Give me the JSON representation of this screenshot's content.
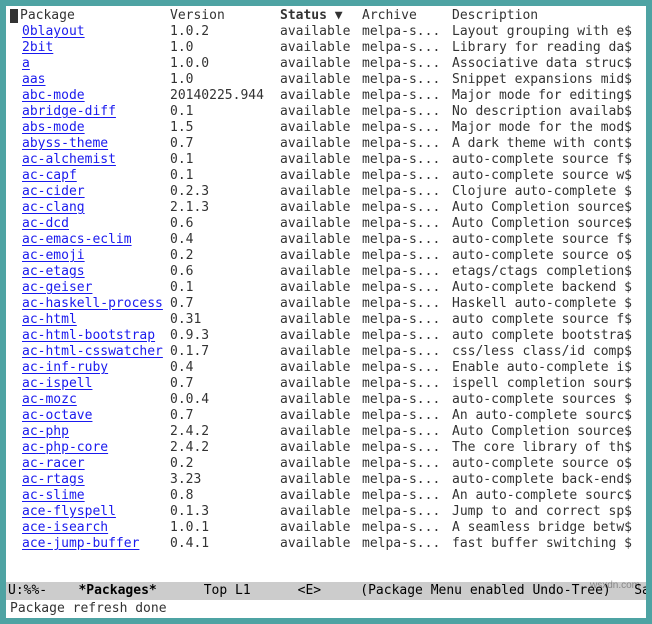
{
  "headers": {
    "package": "Package",
    "version": "Version",
    "status": "Status ▼",
    "archive": "Archive",
    "description": "Description"
  },
  "packages": [
    {
      "name": "0blayout",
      "version": "1.0.2",
      "status": "available",
      "archive": "melpa-s...",
      "desc": "Layout grouping with e$"
    },
    {
      "name": "2bit",
      "version": "1.0",
      "status": "available",
      "archive": "melpa-s...",
      "desc": "Library for reading da$"
    },
    {
      "name": "a",
      "version": "1.0.0",
      "status": "available",
      "archive": "melpa-s...",
      "desc": "Associative data struc$"
    },
    {
      "name": "aas",
      "version": "1.0",
      "status": "available",
      "archive": "melpa-s...",
      "desc": "Snippet expansions mid$"
    },
    {
      "name": "abc-mode",
      "version": "20140225.944",
      "status": "available",
      "archive": "melpa-s...",
      "desc": "Major mode for editing$"
    },
    {
      "name": "abridge-diff",
      "version": "0.1",
      "status": "available",
      "archive": "melpa-s...",
      "desc": "No description availab$"
    },
    {
      "name": "abs-mode",
      "version": "1.5",
      "status": "available",
      "archive": "melpa-s...",
      "desc": "Major mode for the mod$"
    },
    {
      "name": "abyss-theme",
      "version": "0.7",
      "status": "available",
      "archive": "melpa-s...",
      "desc": "A dark theme with cont$"
    },
    {
      "name": "ac-alchemist",
      "version": "0.1",
      "status": "available",
      "archive": "melpa-s...",
      "desc": "auto-complete source f$"
    },
    {
      "name": "ac-capf",
      "version": "0.1",
      "status": "available",
      "archive": "melpa-s...",
      "desc": "auto-complete source w$"
    },
    {
      "name": "ac-cider",
      "version": "0.2.3",
      "status": "available",
      "archive": "melpa-s...",
      "desc": "Clojure auto-complete $"
    },
    {
      "name": "ac-clang",
      "version": "2.1.3",
      "status": "available",
      "archive": "melpa-s...",
      "desc": "Auto Completion source$"
    },
    {
      "name": "ac-dcd",
      "version": "0.6",
      "status": "available",
      "archive": "melpa-s...",
      "desc": "Auto Completion source$"
    },
    {
      "name": "ac-emacs-eclim",
      "version": "0.4",
      "status": "available",
      "archive": "melpa-s...",
      "desc": "auto-complete source f$"
    },
    {
      "name": "ac-emoji",
      "version": "0.2",
      "status": "available",
      "archive": "melpa-s...",
      "desc": "auto-complete source o$"
    },
    {
      "name": "ac-etags",
      "version": "0.6",
      "status": "available",
      "archive": "melpa-s...",
      "desc": "etags/ctags completion$"
    },
    {
      "name": "ac-geiser",
      "version": "0.1",
      "status": "available",
      "archive": "melpa-s...",
      "desc": "Auto-complete backend $"
    },
    {
      "name": "ac-haskell-process",
      "version": "0.7",
      "status": "available",
      "archive": "melpa-s...",
      "desc": "Haskell auto-complete $"
    },
    {
      "name": "ac-html",
      "version": "0.31",
      "status": "available",
      "archive": "melpa-s...",
      "desc": "auto complete source f$"
    },
    {
      "name": "ac-html-bootstrap",
      "version": "0.9.3",
      "status": "available",
      "archive": "melpa-s...",
      "desc": "auto complete bootstra$"
    },
    {
      "name": "ac-html-csswatcher",
      "version": "0.1.7",
      "status": "available",
      "archive": "melpa-s...",
      "desc": "css/less class/id comp$"
    },
    {
      "name": "ac-inf-ruby",
      "version": "0.4",
      "status": "available",
      "archive": "melpa-s...",
      "desc": "Enable auto-complete i$"
    },
    {
      "name": "ac-ispell",
      "version": "0.7",
      "status": "available",
      "archive": "melpa-s...",
      "desc": "ispell completion sour$"
    },
    {
      "name": "ac-mozc",
      "version": "0.0.4",
      "status": "available",
      "archive": "melpa-s...",
      "desc": "auto-complete sources $"
    },
    {
      "name": "ac-octave",
      "version": "0.7",
      "status": "available",
      "archive": "melpa-s...",
      "desc": "An auto-complete sourc$"
    },
    {
      "name": "ac-php",
      "version": "2.4.2",
      "status": "available",
      "archive": "melpa-s...",
      "desc": "Auto Completion source$"
    },
    {
      "name": "ac-php-core",
      "version": "2.4.2",
      "status": "available",
      "archive": "melpa-s...",
      "desc": "The core library of th$"
    },
    {
      "name": "ac-racer",
      "version": "0.2",
      "status": "available",
      "archive": "melpa-s...",
      "desc": "auto-complete source o$"
    },
    {
      "name": "ac-rtags",
      "version": "3.23",
      "status": "available",
      "archive": "melpa-s...",
      "desc": "auto-complete back-end$"
    },
    {
      "name": "ac-slime",
      "version": "0.8",
      "status": "available",
      "archive": "melpa-s...",
      "desc": "An auto-complete sourc$"
    },
    {
      "name": "ace-flyspell",
      "version": "0.1.3",
      "status": "available",
      "archive": "melpa-s...",
      "desc": "Jump to and correct sp$"
    },
    {
      "name": "ace-isearch",
      "version": "1.0.1",
      "status": "available",
      "archive": "melpa-s...",
      "desc": "A seamless bridge betw$"
    },
    {
      "name": "ace-jump-buffer",
      "version": "0.4.1",
      "status": "available",
      "archive": "melpa-s...",
      "desc": "fast buffer switching $"
    }
  ],
  "mode_line": {
    "left": "U:%%-",
    "buffer": "*Packages*",
    "pos": "Top L1",
    "enc": "<E>",
    "modes": "(Package Menu enabled Undo-Tree)",
    "right": "Sat Jan "
  },
  "echo": "Package refresh done",
  "watermark": "wsxdn.com"
}
